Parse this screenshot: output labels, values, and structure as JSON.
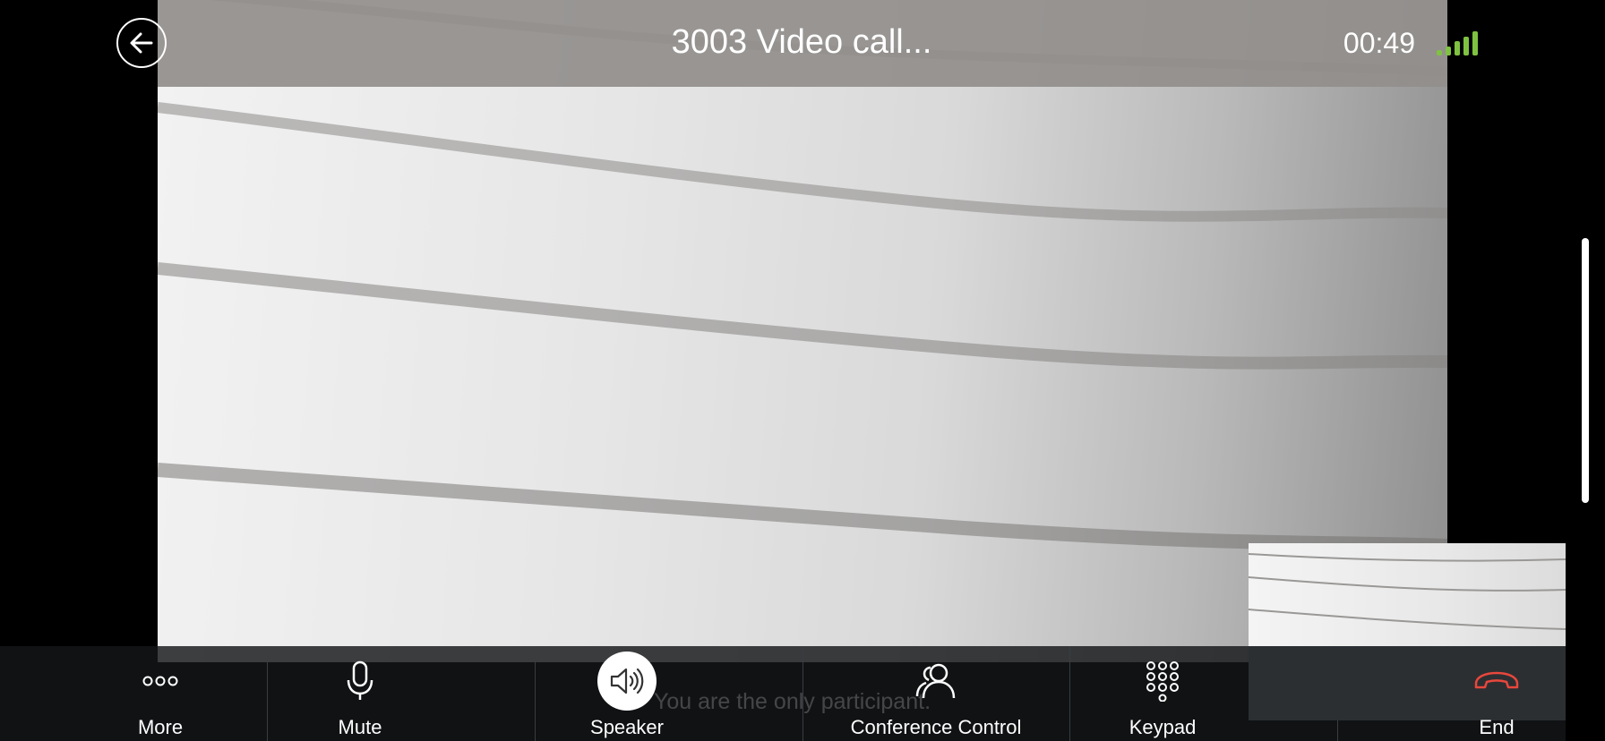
{
  "header": {
    "title": "3003 Video call...",
    "timer": "00:49",
    "signal_color": "#7fc241"
  },
  "icons": {
    "back": "back-arrow-icon",
    "signal": "signal-strength-icon"
  },
  "status": {
    "only_participant": "You are the only participant."
  },
  "controls": [
    {
      "label": "More",
      "icon": "more-dots-icon"
    },
    {
      "label": "Mute",
      "icon": "microphone-icon"
    },
    {
      "label": "Speaker",
      "icon": "speaker-icon"
    },
    {
      "label": "Conference Control",
      "icon": "conference-icon"
    },
    {
      "label": "Keypad",
      "icon": "keypad-icon"
    },
    {
      "label": "End",
      "icon": "end-call-icon",
      "color": "#e8473c"
    }
  ]
}
